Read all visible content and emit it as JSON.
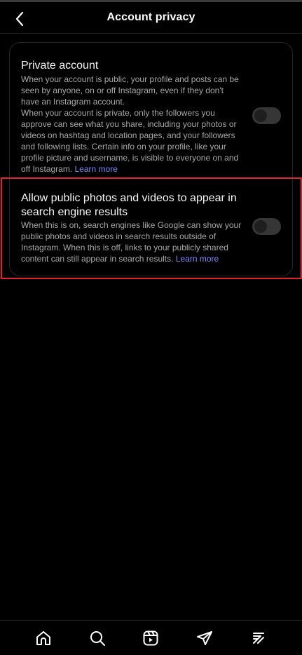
{
  "header": {
    "title": "Account privacy",
    "back_icon": "chevron-left-icon"
  },
  "private_account": {
    "title": "Private account",
    "desc_part1": "When your account is public, your profile and posts can be seen by anyone, on or off Instagram, even if they don't have an Instagram account.",
    "desc_part2": "When your account is private, only the followers you approve can see what you share, including your photos or videos on hashtag and location pages, and your followers and following lists. Certain info on your profile, like your profile picture and username, is visible to everyone on and off Instagram.",
    "learn_more": "Learn more",
    "enabled": false
  },
  "search_engine": {
    "title": "Allow public photos and videos to appear in search engine results",
    "desc": "When this is on, search engines like Google can show your public photos and videos in search results outside of Instagram. When this is off, links to your publicly shared content can still appear in search results.",
    "learn_more": "Learn more",
    "enabled": false
  },
  "bottom_nav": {
    "items": [
      "home-icon",
      "search-icon",
      "reels-icon",
      "direct-messages-icon",
      "activity-icon"
    ]
  },
  "colors": {
    "background": "#000000",
    "link": "#7c8cff",
    "highlight": "#e2232c",
    "toggle_off": "#363636"
  }
}
